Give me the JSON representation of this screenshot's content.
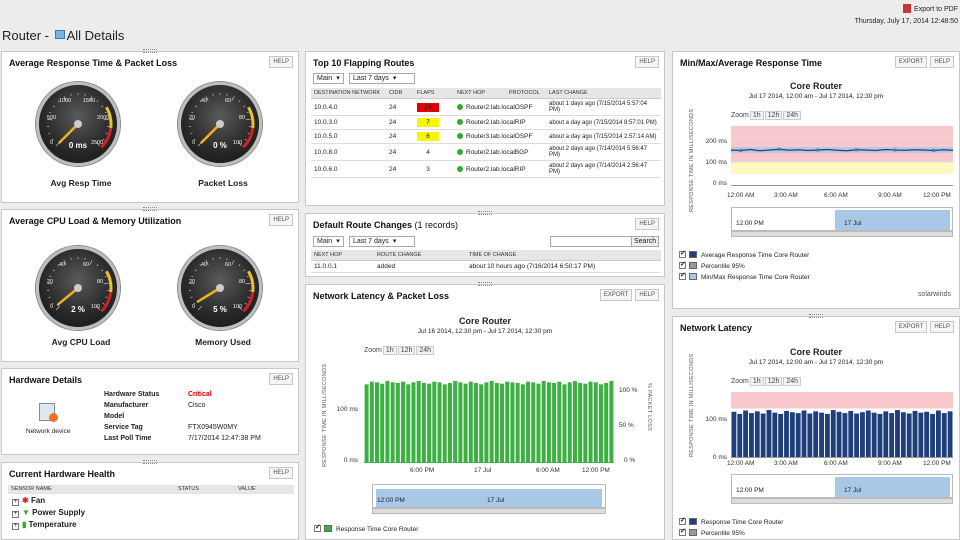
{
  "header": {
    "title": "Router - ",
    "subtitle": "All Details",
    "export_pdf": "Export to PDF",
    "date": "Thursday, July 17, 2014 12:48:50"
  },
  "help": "HELP",
  "export": "EXPORT",
  "resp": {
    "title": "Average Response Time & Packet Loss",
    "g1": {
      "value": "0 ms",
      "label": "Avg Resp Time",
      "ticks": [
        "1000",
        "1500",
        "500",
        "2000",
        "0",
        "2500"
      ],
      "level": 0
    },
    "g2": {
      "value": "0 %",
      "label": "Packet Loss",
      "ticks": [
        "40",
        "60",
        "20",
        "80",
        "0",
        "100"
      ],
      "level": 0
    }
  },
  "cpu": {
    "title": "Average CPU Load & Memory Utilization",
    "g1": {
      "value": "2 %",
      "label": "Avg CPU Load",
      "ticks": [
        "40",
        "60",
        "20",
        "80",
        "0",
        "100"
      ],
      "level": 2
    },
    "g2": {
      "value": "5 %",
      "label": "Memory Used",
      "ticks": [
        "40",
        "60",
        "20",
        "80",
        "0",
        "100"
      ],
      "level": 5
    }
  },
  "hw": {
    "title": "Hardware Details",
    "device": "Network device",
    "rows": [
      {
        "k": "Hardware Status",
        "v": "Critical"
      },
      {
        "k": "Manufacturer",
        "v": "Cisco"
      },
      {
        "k": "Model",
        "v": ""
      },
      {
        "k": "Service Tag",
        "v": "FTX0945W0MY"
      },
      {
        "k": "Last Poll Time",
        "v": "7/17/2014 12:47:38 PM"
      }
    ]
  },
  "health": {
    "title": "Current Hardware Health",
    "cols": [
      "SENSOR NAME",
      "STATUS",
      "VALUE"
    ],
    "items": [
      "Fan",
      "Power Supply",
      "Temperature"
    ]
  },
  "flap": {
    "title": "Top 10 Flapping Routes",
    "filter1": "Main",
    "filter2": "Last 7 days",
    "cols": [
      "DESTINATION NETWORK",
      "CIDR",
      "FLAPS",
      "NEXT HOP",
      "PROTOCOL",
      "LAST CHANGE"
    ],
    "rows": [
      {
        "dest": "10.0.4.0",
        "cidr": "24",
        "flaps": "10",
        "hop": "Router2.lab.local",
        "proto": "OSPF",
        "change": "about 1 days ago (7/15/2014 5:57:04 PM)",
        "color": "#e00000"
      },
      {
        "dest": "10.0.3.0",
        "cidr": "24",
        "flaps": "7",
        "hop": "Router2.lab.local",
        "proto": "RIP",
        "change": "about a day ago (7/15/2014 8:57:01 PM)",
        "color": "#f5f500"
      },
      {
        "dest": "10.0.5.0",
        "cidr": "24",
        "flaps": "6",
        "hop": "Router3.lab.local",
        "proto": "OSPF",
        "change": "about a day ago (7/15/2014 2:57:14 AM)",
        "color": "#f5f500"
      },
      {
        "dest": "10.0.8.0",
        "cidr": "24",
        "flaps": "4",
        "hop": "Router2.lab.local",
        "proto": "BGP",
        "change": "about 2 days ago (7/14/2014 5:56:47 PM)",
        "color": ""
      },
      {
        "dest": "10.0.6.0",
        "cidr": "24",
        "flaps": "3",
        "hop": "Router2.lab.local",
        "proto": "RIP",
        "change": "about 2 days ago (7/14/2014 2:56:47 PM)",
        "color": ""
      }
    ]
  },
  "drc": {
    "title": "Default Route Changes",
    "count": "(1 records)",
    "filter1": "Main",
    "filter2": "Last 7 days",
    "search": "Search",
    "cols": [
      "NEXT HOP",
      "ROUTE CHANGE",
      "TIME OF CHANGE"
    ],
    "rows": [
      {
        "hop": "11.0.0.1",
        "change": "added",
        "time": "about 10 hours ago (7/16/2014 6:50:17 PM)"
      }
    ]
  },
  "latloss": {
    "title": "Network Latency & Packet Loss",
    "chart_title": "Core Router",
    "chart_sub": "Jul 16 2014, 12:30 pm - Jul 17 2014, 12:30 pm",
    "zoom": "Zoom",
    "z": [
      "1h",
      "12h",
      "24h"
    ],
    "yaxis": "RESPONSE TIME IN MILLISECONDS",
    "y2axis": "% PACKET LOSS",
    "yticks": [
      "100 ms",
      "0 ms"
    ],
    "y2ticks": [
      "100 %",
      "50 %",
      "0 %"
    ],
    "xticks": [
      "6:00 PM",
      "17 Jul",
      "6:00 AM",
      "12:00 PM"
    ],
    "nav": [
      "12:00 PM",
      "17 Jul"
    ],
    "legend": [
      "Response Time Core Router"
    ]
  },
  "minmax": {
    "title": "Min/Max/Average Response Time",
    "chart_title": "Core Router",
    "chart_sub": "Jul 17 2014, 12:00 am - Jul 17 2014, 12:30 pm",
    "zoom": "Zoom",
    "z": [
      "1h",
      "12h",
      "24h"
    ],
    "yaxis": "RESPONSE TIME IN MILLISECONDS",
    "yticks": [
      "200 ms",
      "100 ms",
      "0 ms"
    ],
    "xticks": [
      "12:00 AM",
      "3:00 AM",
      "6:00 AM",
      "9:00 AM",
      "12:00 PM"
    ],
    "nav": [
      "12:00 PM",
      "17 Jul"
    ],
    "legend": [
      "Average Response Time Core Router",
      "Percentile 95%",
      "Min/Max Response Time Core Router"
    ],
    "brand": "solarwinds"
  },
  "netlat": {
    "title": "Network Latency",
    "chart_title": "Core Router",
    "chart_sub": "Jul 17 2014, 12:00 am - Jul 17 2014, 12:30 pm",
    "zoom": "Zoom",
    "z": [
      "1h",
      "12h",
      "24h"
    ],
    "yaxis": "RESPONSE TIME IN MILLISECONDS",
    "yticks": [
      "100 ms",
      "0 ms"
    ],
    "xticks": [
      "12:00 AM",
      "3:00 AM",
      "6:00 AM",
      "9:00 AM",
      "12:00 PM"
    ],
    "nav": [
      "12:00 PM",
      "17 Jul"
    ],
    "legend": [
      "Response Time Core Router",
      "Percentile 95%"
    ]
  },
  "colors": {
    "green": "#3cb043",
    "blue": "#1f3f7a",
    "pink": "#f8c8cc",
    "critical": "#d00000"
  },
  "chart_data": [
    {
      "type": "bar",
      "title": "Core Router",
      "ylabel": "RESPONSE TIME IN MILLISECONDS",
      "ylim": [
        0,
        150
      ],
      "series": [
        {
          "name": "Response Time Core Router",
          "values": [
            118,
            122,
            121,
            119,
            123,
            121,
            120,
            122,
            118,
            121,
            123,
            120,
            119,
            122,
            121,
            118,
            120,
            123,
            121,
            119,
            122,
            120,
            118,
            121,
            123,
            120,
            119,
            122,
            121,
            120,
            118,
            122,
            121,
            119,
            123,
            121,
            120,
            122,
            118,
            121,
            123,
            120,
            119,
            122,
            121,
            118,
            120,
            123
          ]
        }
      ]
    },
    {
      "type": "line",
      "title": "Core Router",
      "ylabel": "RESPONSE TIME IN MILLISECONDS",
      "ylim": [
        0,
        250
      ],
      "series": [
        {
          "name": "Average Response Time Core Router",
          "values": [
            150,
            148,
            152,
            147,
            150,
            153,
            149,
            151,
            148,
            150,
            152,
            149,
            147,
            151,
            150,
            148,
            152,
            150,
            149,
            151,
            150,
            148,
            151,
            149
          ]
        }
      ]
    },
    {
      "type": "bar",
      "title": "Core Router",
      "ylabel": "RESPONSE TIME IN MILLISECONDS",
      "ylim": [
        0,
        150
      ],
      "series": [
        {
          "name": "Response Time Core Router",
          "values": [
            105,
            100,
            108,
            102,
            106,
            101,
            109,
            103,
            100,
            107,
            104,
            102,
            108,
            101,
            106,
            103,
            100,
            109,
            105,
            102,
            107,
            101,
            104,
            108,
            103,
            100,
            106,
            102,
            109,
            104,
            101,
            107,
            103,
            105,
            100,
            108,
            102,
            106
          ]
        }
      ]
    }
  ]
}
